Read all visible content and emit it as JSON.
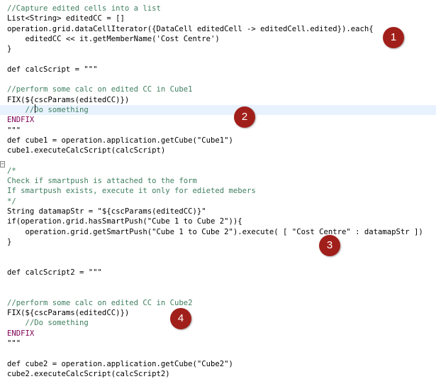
{
  "code_lines": [
    {
      "text": "//Capture edited cells into a list",
      "style": "comment"
    },
    {
      "text": "List<String> editedCC = []",
      "style": "code"
    },
    {
      "text": "operation.grid.dataCellIterator({DataCell editedCell -> editedCell.edited}).each{",
      "style": "code"
    },
    {
      "text": "    editedCC << it.getMemberName('Cost Centre')",
      "style": "code"
    },
    {
      "text": "}",
      "style": "code"
    },
    {
      "text": "",
      "style": "code"
    },
    {
      "text": "def calcScript = \"\"\"",
      "style": "code"
    },
    {
      "text": "",
      "style": "code"
    },
    {
      "text": "//perform some calc on edited CC in Cube1",
      "style": "comment"
    },
    {
      "text": "FIX(${cscParams(editedCC)})",
      "style": "code"
    },
    {
      "text": "    //Do something",
      "style": "comment"
    },
    {
      "text": "ENDFIX",
      "style": "kw"
    },
    {
      "text": "\"\"\"",
      "style": "code"
    },
    {
      "text": "def cube1 = operation.application.getCube(\"Cube1\")",
      "style": "code"
    },
    {
      "text": "cube1.executeCalcScript(calcScript)",
      "style": "code"
    },
    {
      "text": "",
      "style": "code"
    },
    {
      "text": "/*",
      "style": "comment"
    },
    {
      "text": "Check if smartpush is attached to the form",
      "style": "comment"
    },
    {
      "text": "If smartpush exists, execute it only for edieted mebers",
      "style": "comment"
    },
    {
      "text": "*/",
      "style": "comment"
    },
    {
      "text": "String datamapStr = \"${cscParams(editedCC)}\"",
      "style": "code"
    },
    {
      "text": "if(operation.grid.hasSmartPush(\"Cube 1 to Cube 2\")){",
      "style": "code"
    },
    {
      "text": "    operation.grid.getSmartPush(\"Cube 1 to Cube 2\").execute( [ \"Cost Centre\" : datamapStr ])",
      "style": "code"
    },
    {
      "text": "}",
      "style": "code"
    },
    {
      "text": "",
      "style": "code"
    },
    {
      "text": "",
      "style": "code"
    },
    {
      "text": "def calcScript2 = \"\"\"",
      "style": "code"
    },
    {
      "text": "",
      "style": "code"
    },
    {
      "text": "",
      "style": "code"
    },
    {
      "text": "//perform some calc on edited CC in Cube2",
      "style": "comment"
    },
    {
      "text": "FIX(${cscParams(editedCC)})",
      "style": "code"
    },
    {
      "text": "    //Do something",
      "style": "comment"
    },
    {
      "text": "ENDFIX",
      "style": "kw"
    },
    {
      "text": "\"\"\"",
      "style": "code"
    },
    {
      "text": "",
      "style": "code"
    },
    {
      "text": "def cube2 = operation.application.getCube(\"Cube2\")",
      "style": "code"
    },
    {
      "text": "cube2.executeCalcScript(calcScript2)",
      "style": "code"
    }
  ],
  "highlighted_line": 10,
  "markers": [
    {
      "label": "1",
      "color": "#a11f1a"
    },
    {
      "label": "2",
      "color": "#a11f1a"
    },
    {
      "label": "3",
      "color": "#a11f1a"
    },
    {
      "label": "4",
      "color": "#a11f1a"
    }
  ],
  "fold_icon": "fold-collapse-icon"
}
